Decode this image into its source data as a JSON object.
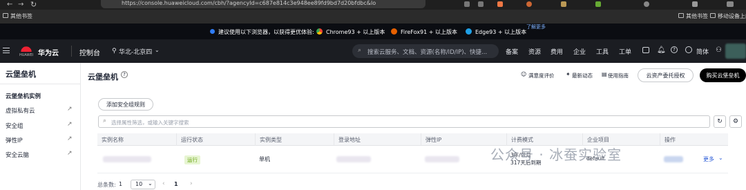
{
  "browser": {
    "url": "https://console.huaweicloud.com/cbh/?agencyId=c687e814c3e948ee89fd9bd7d20bfdbc&lo",
    "bookmark_left": "其他书签",
    "bookmark_right_1": "其他书签",
    "bookmark_right_2": "移动设备上的"
  },
  "notice": {
    "text": "建议使用以下浏览器，以获得更优体验:",
    "chrome": "Chrome93 + 以上版本",
    "firefox": "FireFox91 + 以上版本",
    "edge": "Edge93 + 以上版本",
    "more": "了解更多"
  },
  "topnav": {
    "brand": "华为云",
    "brand_small": "HUAWEI",
    "console": "控制台",
    "region": "华北-北京四",
    "search_placeholder": "搜索云服务、文档、资源(名称/ID/IP)、快捷...",
    "links": [
      "备案",
      "资源",
      "费用",
      "企业",
      "工具",
      "工单"
    ],
    "lang": "简体"
  },
  "sidebar": {
    "title": "云堡垒机",
    "items": [
      {
        "label": "云堡垒机实例",
        "active": true
      },
      {
        "label": "虚拟私有云"
      },
      {
        "label": "安全组"
      },
      {
        "label": "弹性IP"
      },
      {
        "label": "安全云脑"
      }
    ]
  },
  "main": {
    "title": "云堡垒机",
    "satisfaction": "满意度评价",
    "latest": "最新动态",
    "guide": "使用指南",
    "authorize_btn": "云资产委托授权",
    "buy_btn": "购买云堡垒机",
    "add_rule_btn": "添加安全组规则",
    "filter_placeholder": "选择属性筛选，或输入关键字搜索",
    "columns": [
      "实例名称",
      "运行状态",
      "实例类型",
      "登录地址",
      "弹性IP",
      "计费模式",
      "企业项目",
      "操作"
    ],
    "row": {
      "status": "运行",
      "type": "单机",
      "billing_1": "3年/包月",
      "billing_2": "317天后到期",
      "enterprise": "default",
      "op": "更多"
    },
    "pagination": {
      "total_label": "总条数:",
      "total": "1",
      "page_size": "10",
      "page": "1"
    }
  },
  "watermark": "公众号 · 冰蚕实验室"
}
